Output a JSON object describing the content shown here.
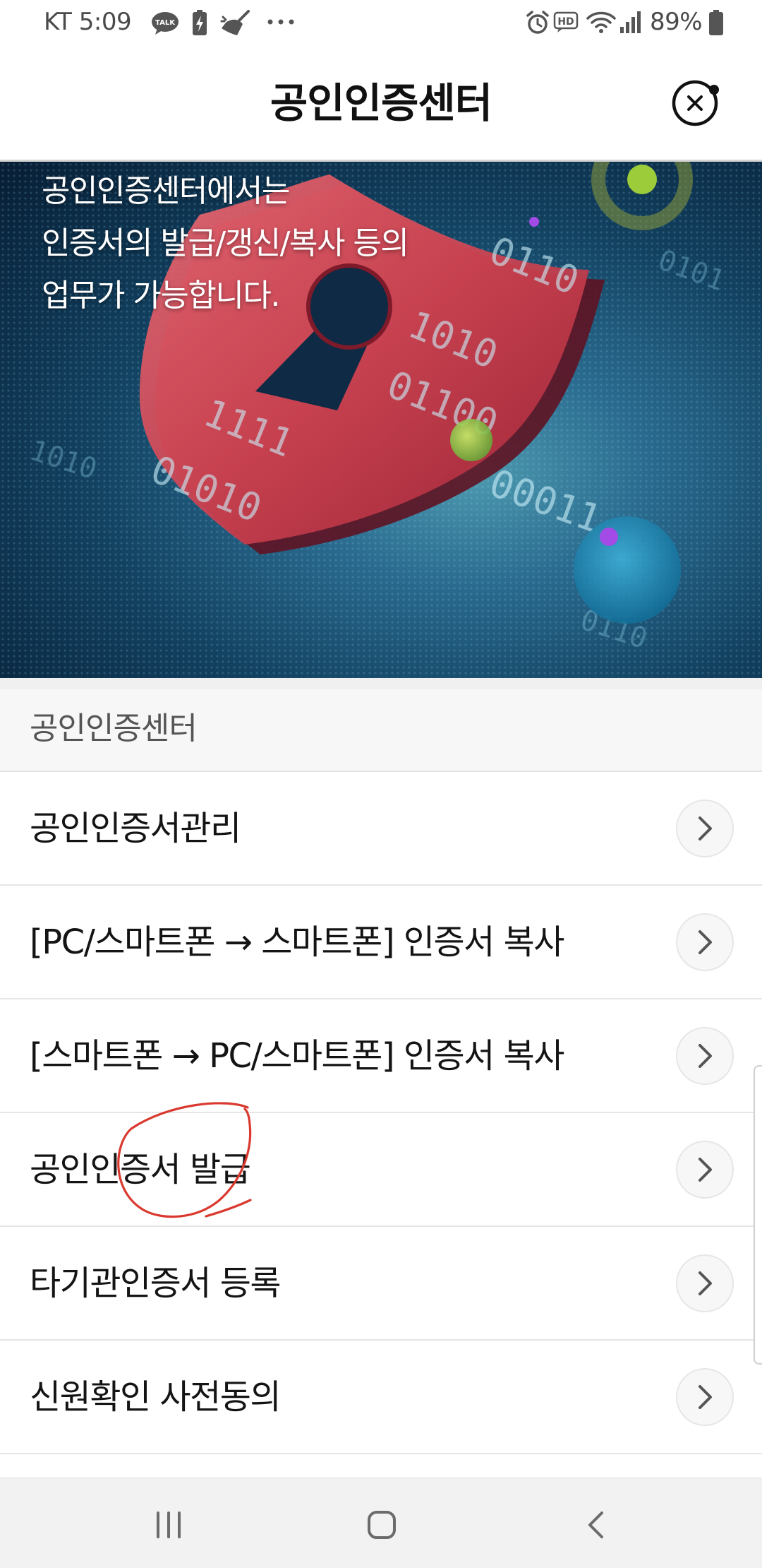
{
  "status_bar": {
    "carrier_time": "KT 5:09",
    "battery_percent": "89%",
    "hd_label": "HD",
    "talk_label": "TALK",
    "left_icons": [
      "kakaotalk-icon",
      "battery-charging-icon",
      "cleaner-icon",
      "more-dots-icon"
    ],
    "right_icons": [
      "alarm-icon",
      "hd-voice-icon",
      "wifi-icon",
      "signal-icon",
      "battery-icon"
    ]
  },
  "header": {
    "title": "공인인증센터",
    "close_icon": "close-circle-icon"
  },
  "banner": {
    "lines": [
      "공인인증센터에서는",
      "인증서의 발급/갱신/복사 등의",
      "업무가 가능합니다."
    ],
    "image": "red-shield-keyhole-illustration",
    "binary": [
      "0110",
      "1010",
      "01100",
      "1111",
      "01010",
      "00011",
      "0101"
    ]
  },
  "section": {
    "title": "공인인증센터"
  },
  "menu": {
    "chevron_icon": "chevron-right-icon",
    "items": [
      {
        "label": "공인인증서관리"
      },
      {
        "label": "[PC/스마트폰 → 스마트폰] 인증서 복사"
      },
      {
        "label": "[스마트폰 → PC/스마트폰] 인증서 복사"
      },
      {
        "label": "공인인증서 발급"
      },
      {
        "label": "타기관인증서 등록"
      },
      {
        "label": "신원확인 사전동의"
      }
    ]
  },
  "nav_bar": {
    "icons": [
      "recent-apps-icon",
      "home-icon",
      "back-icon"
    ]
  },
  "colors": {
    "shield_red": "#c8323f",
    "banner_navy": "#0f3a5d",
    "annotation_red": "#d9392e",
    "section_bg": "#f7f7f7",
    "nav_bg": "#f2f2f2"
  }
}
